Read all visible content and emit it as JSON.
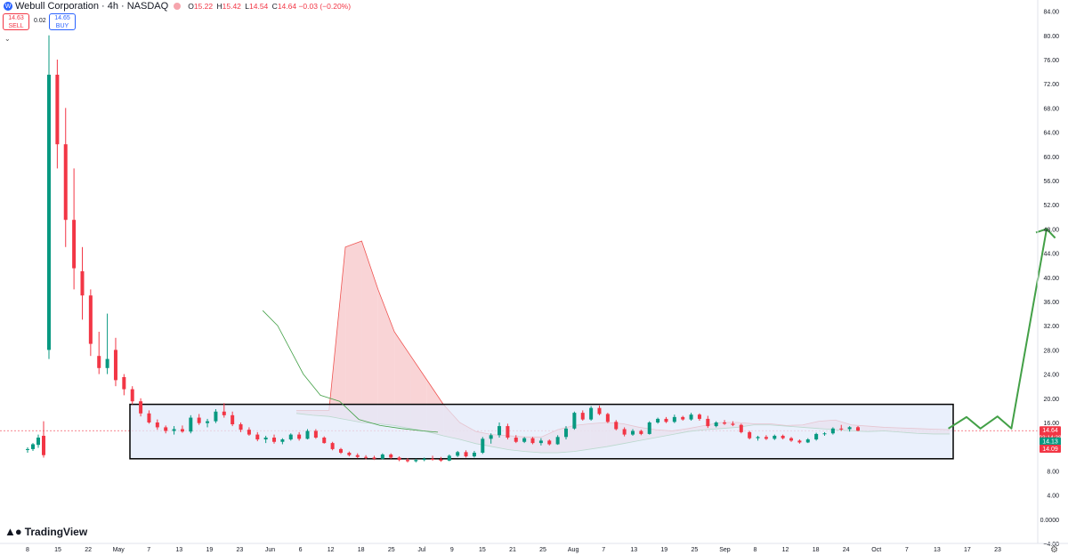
{
  "header": {
    "symbol_title": "Webull Corporation · 4h · NASDAQ",
    "logo_letter": "W",
    "ohlc": [
      {
        "label": "O",
        "value": "15.22"
      },
      {
        "label": "H",
        "value": "15.42"
      },
      {
        "label": "L",
        "value": "14.54"
      },
      {
        "label": "C",
        "value": "14.64"
      },
      {
        "label": "",
        "value": "−0.03 (−0.20%)"
      }
    ]
  },
  "trade": {
    "sell_price": "14.63",
    "sell_label": "SELL",
    "spread": "0.02",
    "buy_price": "14.65",
    "buy_label": "BUY"
  },
  "brand": "TradingView",
  "colors": {
    "up": "#089981",
    "down": "#f23645",
    "kumo_bear": "#f7c9cc",
    "kumo_bull": "#cde8d8",
    "box_fill": "#e3ebfb",
    "arrow": "#43a047",
    "current_price_line": "#f23645"
  },
  "chart_data": {
    "type": "candlestick",
    "indicator": "Ichimoku cloud",
    "y_ticks": [
      "84.00",
      "80.00",
      "76.00",
      "72.00",
      "68.00",
      "64.00",
      "60.00",
      "56.00",
      "52.00",
      "48.00",
      "44.00",
      "40.00",
      "36.00",
      "32.00",
      "28.00",
      "24.00",
      "20.00",
      "16.00",
      "12.00",
      "8.00",
      "4.00",
      "0.0000",
      "−4.00"
    ],
    "ylim": [
      -4,
      84
    ],
    "x_ticks": [
      "8",
      "15",
      "22",
      "May",
      "7",
      "13",
      "19",
      "23",
      "Jun",
      "6",
      "12",
      "18",
      "25",
      "Jul",
      "9",
      "15",
      "21",
      "25",
      "Aug",
      "7",
      "13",
      "19",
      "25",
      "Sep",
      "8",
      "12",
      "18",
      "24",
      "Oct",
      "7",
      "13",
      "17",
      "23"
    ],
    "price_labels": [
      {
        "text": "14.64",
        "sub": "03:14:38",
        "value": 14.64,
        "color": "#f23645"
      },
      {
        "text": "14.13",
        "value": 14.13,
        "color": "#089981"
      },
      {
        "text": "14.09",
        "value": 14.09,
        "color": "#f23645"
      }
    ],
    "candles": [
      [
        11.6,
        11.9,
        11.0,
        11.6
      ],
      [
        11.6,
        12.6,
        11.3,
        12.4
      ],
      [
        12.3,
        14.0,
        11.8,
        13.5
      ],
      [
        13.8,
        16.2,
        10.2,
        10.6
      ],
      [
        28.0,
        80.0,
        26.5,
        73.5
      ],
      [
        73.5,
        76.0,
        58.0,
        62.0
      ],
      [
        62.0,
        68.0,
        45.0,
        49.5
      ],
      [
        49.5,
        58.0,
        38.0,
        41.5
      ],
      [
        41.0,
        45.0,
        33.0,
        37.0
      ],
      [
        37.0,
        38.0,
        27.0,
        29.0
      ],
      [
        27.0,
        31.0,
        24.0,
        25.0
      ],
      [
        25.0,
        34.0,
        24.0,
        26.5
      ],
      [
        28.0,
        30.0,
        22.0,
        23.0
      ],
      [
        23.5,
        24.0,
        20.5,
        21.5
      ],
      [
        21.5,
        22.0,
        19.0,
        19.5
      ],
      [
        19.5,
        20.0,
        17.0,
        17.5
      ],
      [
        17.5,
        18.0,
        15.8,
        16.0
      ],
      [
        16.0,
        16.5,
        14.8,
        15.2
      ],
      [
        15.2,
        15.5,
        14.2,
        14.6
      ],
      [
        14.6,
        15.4,
        14.0,
        14.9
      ],
      [
        14.9,
        15.5,
        14.3,
        14.5
      ],
      [
        14.5,
        17.2,
        14.2,
        16.8
      ],
      [
        16.8,
        17.4,
        15.6,
        15.9
      ],
      [
        15.9,
        16.6,
        15.2,
        16.2
      ],
      [
        16.2,
        18.2,
        15.9,
        17.8
      ],
      [
        17.8,
        19.2,
        16.8,
        17.2
      ],
      [
        17.2,
        17.8,
        15.4,
        15.7
      ],
      [
        15.7,
        16.0,
        14.4,
        14.8
      ],
      [
        14.8,
        15.2,
        13.8,
        14.0
      ],
      [
        14.0,
        14.4,
        12.9,
        13.2
      ],
      [
        13.2,
        13.8,
        12.6,
        13.5
      ],
      [
        13.5,
        14.0,
        12.5,
        12.8
      ],
      [
        12.8,
        13.4,
        12.4,
        13.2
      ],
      [
        13.2,
        14.2,
        13.0,
        14.0
      ],
      [
        14.0,
        14.4,
        13.0,
        13.3
      ],
      [
        13.3,
        14.9,
        13.2,
        14.6
      ],
      [
        14.6,
        14.9,
        13.3,
        13.5
      ],
      [
        13.5,
        13.7,
        12.5,
        12.6
      ],
      [
        12.6,
        12.8,
        11.4,
        11.6
      ],
      [
        11.6,
        11.8,
        10.8,
        11.0
      ],
      [
        11.0,
        11.2,
        10.4,
        10.6
      ],
      [
        10.6,
        10.9,
        10.1,
        10.3
      ],
      [
        10.3,
        10.6,
        9.9,
        10.2
      ],
      [
        10.2,
        10.5,
        9.8,
        10.0
      ],
      [
        10.0,
        10.9,
        9.9,
        10.7
      ],
      [
        10.7,
        10.9,
        10.0,
        10.2
      ],
      [
        10.2,
        10.4,
        9.6,
        9.8
      ],
      [
        9.8,
        10.1,
        9.4,
        9.6
      ],
      [
        9.6,
        10.0,
        9.4,
        9.8
      ],
      [
        9.8,
        10.2,
        9.6,
        10.0
      ],
      [
        10.0,
        10.5,
        9.7,
        9.9
      ],
      [
        9.9,
        10.3,
        9.5,
        9.7
      ],
      [
        9.7,
        10.7,
        9.6,
        10.5
      ],
      [
        10.5,
        11.3,
        10.3,
        11.1
      ],
      [
        11.1,
        11.4,
        10.2,
        10.4
      ],
      [
        10.4,
        11.3,
        10.2,
        11.0
      ],
      [
        11.0,
        13.6,
        10.8,
        13.3
      ],
      [
        13.3,
        14.2,
        12.5,
        13.9
      ],
      [
        13.9,
        16.0,
        13.5,
        15.4
      ],
      [
        15.4,
        15.8,
        13.2,
        13.5
      ],
      [
        13.5,
        13.9,
        12.6,
        12.8
      ],
      [
        12.8,
        13.6,
        12.6,
        13.4
      ],
      [
        13.4,
        13.6,
        12.4,
        12.6
      ],
      [
        12.6,
        13.4,
        12.2,
        13.0
      ],
      [
        13.0,
        13.2,
        12.2,
        12.4
      ],
      [
        12.4,
        13.9,
        12.3,
        13.6
      ],
      [
        13.6,
        15.4,
        13.2,
        15.0
      ],
      [
        15.0,
        17.8,
        14.8,
        17.6
      ],
      [
        17.6,
        18.0,
        16.3,
        16.5
      ],
      [
        16.5,
        18.7,
        16.3,
        18.4
      ],
      [
        18.4,
        18.8,
        17.2,
        17.4
      ],
      [
        17.4,
        17.6,
        15.9,
        16.1
      ],
      [
        16.1,
        16.4,
        14.7,
        14.9
      ],
      [
        14.9,
        15.2,
        13.7,
        14.0
      ],
      [
        14.0,
        14.9,
        13.8,
        14.6
      ],
      [
        14.6,
        14.8,
        13.9,
        14.1
      ],
      [
        14.1,
        16.2,
        14.0,
        16.0
      ],
      [
        16.0,
        16.8,
        15.8,
        16.6
      ],
      [
        16.6,
        16.9,
        15.9,
        16.1
      ],
      [
        16.1,
        17.3,
        15.9,
        16.9
      ],
      [
        16.9,
        17.1,
        16.3,
        16.5
      ],
      [
        16.5,
        17.6,
        16.3,
        17.3
      ],
      [
        17.3,
        17.5,
        16.3,
        16.6
      ],
      [
        16.6,
        17.1,
        15.1,
        15.4
      ],
      [
        15.4,
        16.2,
        15.2,
        16.0
      ],
      [
        16.0,
        16.4,
        15.6,
        15.8
      ],
      [
        15.8,
        16.2,
        15.4,
        15.6
      ],
      [
        15.6,
        15.8,
        14.2,
        14.4
      ],
      [
        14.4,
        14.6,
        13.2,
        13.4
      ],
      [
        13.4,
        13.8,
        13.0,
        13.6
      ],
      [
        13.6,
        13.9,
        13.1,
        13.3
      ],
      [
        13.3,
        14.0,
        13.1,
        13.8
      ],
      [
        13.8,
        14.0,
        13.2,
        13.4
      ],
      [
        13.4,
        13.6,
        12.8,
        13.0
      ],
      [
        13.0,
        13.2,
        12.5,
        12.7
      ],
      [
        12.7,
        13.4,
        12.6,
        13.2
      ],
      [
        13.2,
        14.3,
        13.0,
        14.1
      ],
      [
        14.1,
        14.4,
        13.8,
        14.2
      ],
      [
        14.2,
        15.2,
        14.0,
        15.0
      ],
      [
        15.0,
        15.6,
        14.6,
        14.9
      ],
      [
        14.9,
        15.4,
        14.5,
        15.22
      ],
      [
        15.22,
        15.42,
        14.54,
        14.64
      ]
    ],
    "cloud_boundary": [
      [
        18.0,
        17.5
      ],
      [
        18.0,
        17.2
      ],
      [
        18.0,
        17.0
      ],
      [
        45.0,
        16.5
      ],
      [
        46.0,
        16.0
      ],
      [
        38.0,
        15.8
      ],
      [
        31.0,
        15.5
      ],
      [
        27.0,
        15.0
      ],
      [
        23.0,
        14.5
      ],
      [
        19.0,
        13.8
      ],
      [
        16.0,
        13.2
      ],
      [
        14.5,
        12.5
      ],
      [
        14.0,
        12.0
      ],
      [
        13.8,
        11.5
      ],
      [
        13.6,
        11.2
      ],
      [
        13.6,
        11.0
      ],
      [
        14.8,
        11.0
      ],
      [
        15.5,
        11.2
      ],
      [
        15.8,
        11.6
      ],
      [
        16.0,
        12.0
      ],
      [
        15.8,
        12.5
      ],
      [
        15.2,
        13.0
      ],
      [
        14.8,
        13.5
      ],
      [
        14.6,
        14.0
      ],
      [
        15.0,
        14.5
      ],
      [
        15.5,
        14.8
      ],
      [
        16.0,
        15.0
      ],
      [
        16.0,
        15.2
      ],
      [
        15.8,
        15.6
      ],
      [
        15.8,
        15.6
      ],
      [
        15.5,
        15.4
      ],
      [
        15.6,
        15.2
      ],
      [
        16.2,
        15.0
      ],
      [
        16.4,
        14.8
      ],
      [
        15.6,
        14.6
      ],
      [
        15.4,
        14.5
      ],
      [
        15.2,
        14.6
      ],
      [
        15.1,
        14.4
      ],
      [
        15.0,
        14.2
      ],
      [
        14.9,
        14.1
      ],
      [
        14.8,
        14.1
      ]
    ],
    "lagging_span": [
      [
        34.5,
        0.246
      ],
      [
        32.0,
        0.26
      ],
      [
        28.0,
        0.272
      ],
      [
        24.0,
        0.284
      ],
      [
        20.5,
        0.3
      ],
      [
        19.5,
        0.318
      ],
      [
        16.5,
        0.336
      ],
      [
        15.5,
        0.356
      ],
      [
        15.0,
        0.376
      ],
      [
        14.6,
        0.396
      ],
      [
        14.4,
        0.41
      ]
    ],
    "annotations": {
      "range_box": {
        "y_top": 19.0,
        "y_bottom": 10.0,
        "label": ""
      },
      "projection": [
        [
          15.0,
          0.888
        ],
        [
          16.9,
          0.905
        ],
        [
          15.0,
          0.918
        ],
        [
          17.0,
          0.934
        ],
        [
          15.0,
          0.947
        ],
        [
          48.0,
          0.98
        ],
        [
          46.5,
          0.988
        ]
      ]
    }
  }
}
